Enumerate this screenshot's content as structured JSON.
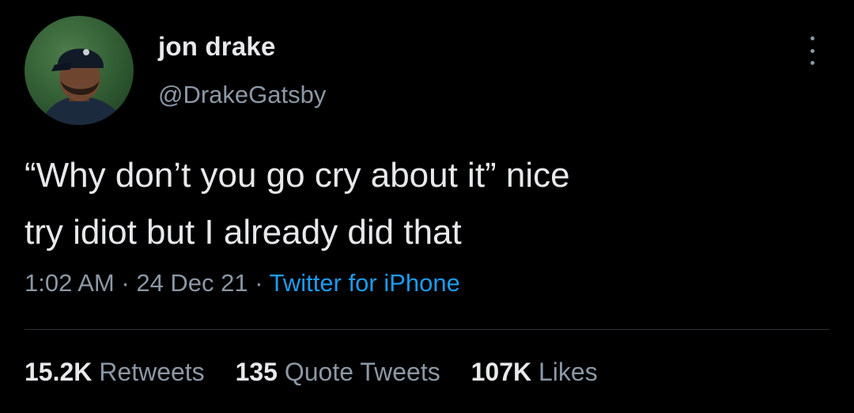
{
  "tweet": {
    "author": {
      "name": "jon drake",
      "handle": "@DrakeGatsby"
    },
    "text_line1": "“Why don’t you go cry about it” nice",
    "text_line2": "try idiot but I already did that",
    "time": "1:02 AM",
    "separator": "·",
    "date": "24 Dec 21",
    "source": "Twitter for iPhone"
  },
  "stats": {
    "retweets": {
      "count": "15.2K",
      "label": "Retweets"
    },
    "quotes": {
      "count": "135",
      "label": "Quote Tweets"
    },
    "likes": {
      "count": "107K",
      "label": "Likes"
    }
  },
  "colors": {
    "background": "#000000",
    "text": "#e7e9ea",
    "muted": "#8b98a5",
    "link": "#1d9bf0",
    "divider": "#2f3336"
  },
  "icons": {
    "avatar": "profile-photo",
    "more": "more-options-icon"
  }
}
